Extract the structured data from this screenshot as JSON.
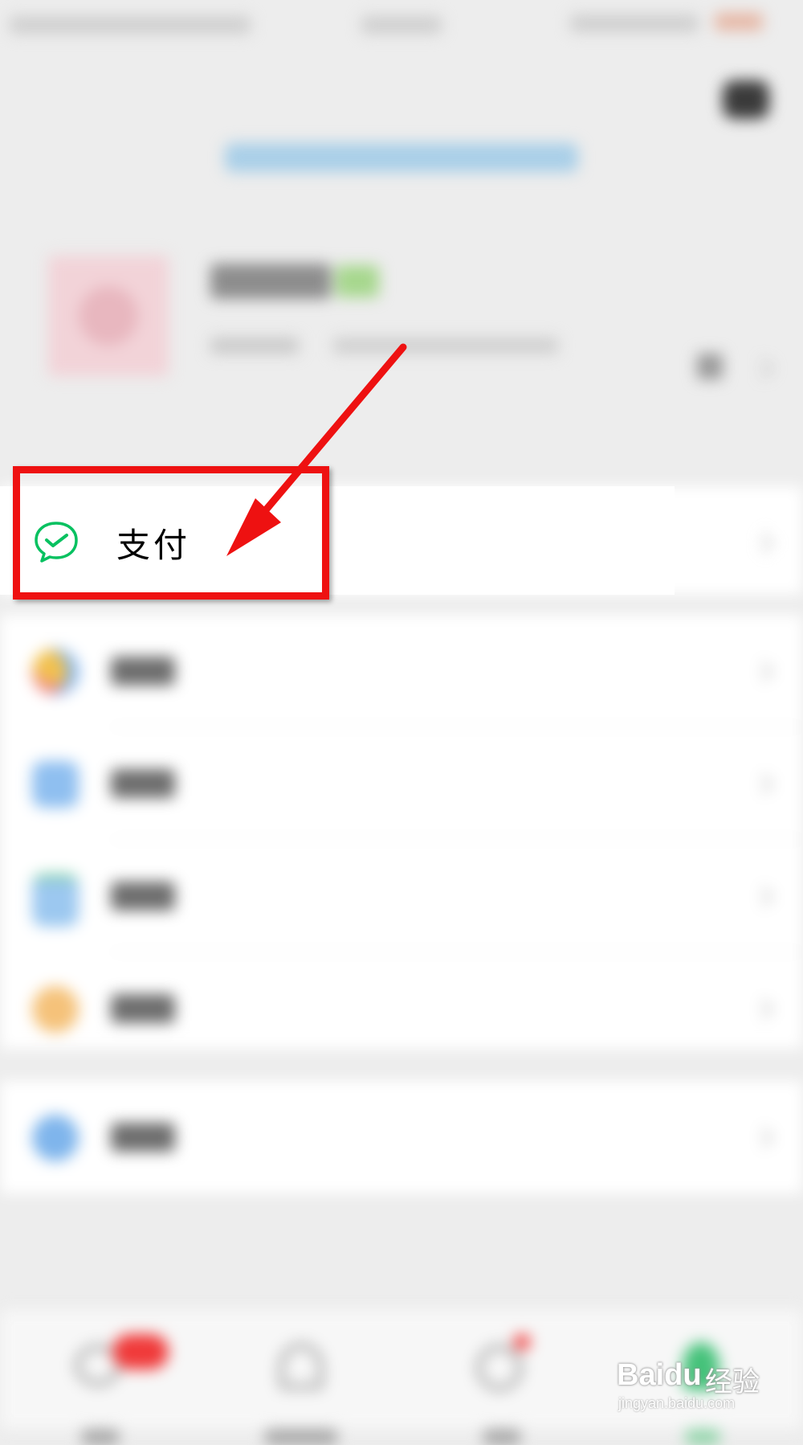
{
  "menu": {
    "pay": {
      "label": "支付",
      "icon": "wechat-pay-icon",
      "color": "#07c160"
    },
    "items": [
      {
        "icon": "favorites-icon"
      },
      {
        "icon": "album-icon"
      },
      {
        "icon": "cards-icon"
      },
      {
        "icon": "sticker-icon"
      },
      {
        "icon": "settings-icon"
      }
    ]
  },
  "annotation": {
    "color": "#ee1111"
  },
  "watermark": {
    "brand": "Baidu",
    "brand_cn": "经验",
    "url": "jingyan.baidu.com"
  }
}
